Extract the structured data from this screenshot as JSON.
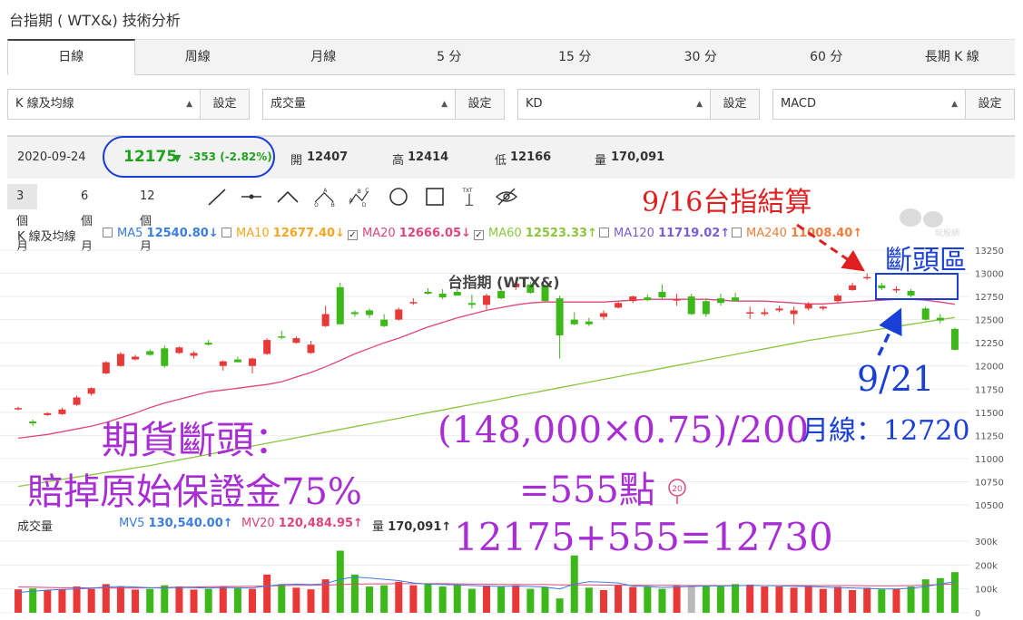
{
  "page": {
    "title": "台指期 ( WTX&) 技術分析"
  },
  "tabs": [
    {
      "label": "日線",
      "active": true
    },
    {
      "label": "周線"
    },
    {
      "label": "月線"
    },
    {
      "label": "5 分"
    },
    {
      "label": "15 分"
    },
    {
      "label": "30 分"
    },
    {
      "label": "60 分"
    },
    {
      "label": "長期 K 線"
    }
  ],
  "selectors": [
    {
      "value": "K 線及均線",
      "button": "設定"
    },
    {
      "value": "成交量",
      "button": "設定"
    },
    {
      "value": "KD",
      "button": "設定"
    },
    {
      "value": "MACD",
      "button": "設定"
    }
  ],
  "quote": {
    "date": "2020-09-24",
    "price": "12175",
    "change": "-353 (-2.82%)",
    "open_label": "開",
    "open": "12407",
    "high_label": "高",
    "high": "12414",
    "low_label": "低",
    "low": "12166",
    "vol_label": "量",
    "vol": "170,091"
  },
  "ranges": [
    "3 個月",
    "6 個月",
    "12 個月"
  ],
  "tools": [
    "line-tool-icon",
    "segment-tool-icon",
    "angle-tool-icon",
    "abc-tool-icon",
    "abcd-tool-icon",
    "circle-tool-icon",
    "rect-tool-icon",
    "text-tool-icon",
    "hide-tool-icon"
  ],
  "tools_text": {
    "text": "TXT"
  },
  "ma_legend": {
    "title": "K 線及均線",
    "items": [
      {
        "name": "MA5",
        "value": "12540.80",
        "arrow": "↓",
        "color": "#3b7de0",
        "checked": false
      },
      {
        "name": "MA10",
        "value": "12677.40",
        "arrow": "↓",
        "color": "#f5a623",
        "checked": false
      },
      {
        "name": "MA20",
        "value": "12666.05",
        "arrow": "↓",
        "color": "#e0457b",
        "checked": true
      },
      {
        "name": "MA60",
        "value": "12523.33",
        "arrow": "↑",
        "color": "#8cc63f",
        "checked": true
      },
      {
        "name": "MA120",
        "value": "11719.02",
        "arrow": "↑",
        "color": "#7b5cd6",
        "checked": false
      },
      {
        "name": "MA240",
        "value": "11008.40",
        "arrow": "↑",
        "color": "#f07e3c",
        "checked": false
      }
    ]
  },
  "vol_legend": {
    "title": "成交量",
    "items": [
      {
        "name": "MV5",
        "value": "130,540.00",
        "arrow": "↑",
        "color": "#3b7de0"
      },
      {
        "name": "MV20",
        "value": "120,484.95",
        "arrow": "↑",
        "color": "#e0457b"
      },
      {
        "name": "量",
        "value": "170,091",
        "arrow": "↑",
        "color": "#333333"
      }
    ]
  },
  "annotations": {
    "settlement": "9/16台指結算",
    "gap_zone": "斷頭區",
    "date_921": "9/21",
    "monthly_line": "月線：12720",
    "liq_title": "期貨斷頭：",
    "liq_desc": "賠掉原始保證金75%",
    "formula": "(148,000×0.75)/200",
    "formula_result": "=555點",
    "sum": "12175+555=12730"
  },
  "watermark": "玩股網",
  "marker_badge": "20",
  "chart_data": {
    "type": "candlestick",
    "title": "台指期 (WTX&)",
    "ylim": [
      10500,
      13250
    ],
    "yticks": [
      10500,
      10750,
      11000,
      11250,
      11500,
      11750,
      12000,
      12250,
      12500,
      12750,
      13000,
      13250
    ],
    "vol_ylim": [
      0,
      300000
    ],
    "vol_ticks": [
      {
        "value": 0,
        "label": "0"
      },
      {
        "value": 100000,
        "label": "100k"
      },
      {
        "value": 200000,
        "label": "200k"
      },
      {
        "value": 300000,
        "label": "300k"
      }
    ],
    "candles": [
      [
        11540,
        11560,
        11520,
        11545
      ],
      [
        11400,
        11420,
        11350,
        11380
      ],
      [
        11470,
        11500,
        11460,
        11490
      ],
      [
        11480,
        11550,
        11470,
        11530
      ],
      [
        11580,
        11680,
        11570,
        11660
      ],
      [
        11700,
        11770,
        11680,
        11760
      ],
      [
        11920,
        12050,
        11910,
        12040
      ],
      [
        12000,
        12150,
        11990,
        12130
      ],
      [
        12070,
        12120,
        12060,
        12100
      ],
      [
        12160,
        12180,
        12110,
        12120
      ],
      [
        12190,
        12220,
        11980,
        12000
      ],
      [
        12140,
        12210,
        12130,
        12200
      ],
      [
        12110,
        12160,
        12080,
        12140
      ],
      [
        12250,
        12280,
        12220,
        12230
      ],
      [
        12000,
        12060,
        11950,
        12050
      ],
      [
        12070,
        12100,
        12040,
        12040
      ],
      [
        12000,
        12090,
        11920,
        12080
      ],
      [
        12130,
        12300,
        12120,
        12280
      ],
      [
        12320,
        12380,
        12290,
        12310
      ],
      [
        12250,
        12320,
        12240,
        12300
      ],
      [
        12140,
        12270,
        12130,
        12230
      ],
      [
        12430,
        12650,
        12420,
        12560
      ],
      [
        12850,
        12900,
        12480,
        12450
      ],
      [
        12580,
        12600,
        12530,
        12560
      ],
      [
        12600,
        12620,
        12520,
        12550
      ],
      [
        12500,
        12560,
        12420,
        12430
      ],
      [
        12500,
        12630,
        12490,
        12610
      ],
      [
        12680,
        12730,
        12660,
        12690
      ],
      [
        12800,
        12840,
        12770,
        12780
      ],
      [
        12780,
        12830,
        12720,
        12740
      ],
      [
        12800,
        12850,
        12780,
        12760
      ],
      [
        12680,
        12770,
        12620,
        12660
      ],
      [
        12660,
        12780,
        12610,
        12760
      ],
      [
        12810,
        12830,
        12720,
        12730
      ],
      [
        12850,
        12900,
        12820,
        12890
      ],
      [
        12880,
        12910,
        12780,
        12790
      ],
      [
        12870,
        12880,
        12690,
        12700
      ],
      [
        12730,
        12760,
        12080,
        12330
      ],
      [
        12500,
        12580,
        12440,
        12450
      ],
      [
        12480,
        12520,
        12430,
        12450
      ],
      [
        12530,
        12600,
        12500,
        12570
      ],
      [
        12630,
        12690,
        12620,
        12680
      ],
      [
        12700,
        12760,
        12680,
        12750
      ],
      [
        12740,
        12770,
        12700,
        12710
      ],
      [
        12800,
        12880,
        12720,
        12740
      ],
      [
        12710,
        12780,
        12650,
        12720
      ],
      [
        12750,
        12780,
        12550,
        12560
      ],
      [
        12700,
        12730,
        12530,
        12560
      ],
      [
        12730,
        12780,
        12650,
        12680
      ],
      [
        12740,
        12790,
        12700,
        12700
      ],
      [
        12580,
        12640,
        12510,
        12580
      ],
      [
        12560,
        12620,
        12540,
        12580
      ],
      [
        12600,
        12650,
        12580,
        12620
      ],
      [
        12560,
        12640,
        12450,
        12600
      ],
      [
        12620,
        12690,
        12600,
        12670
      ],
      [
        12620,
        12650,
        12600,
        12640
      ],
      [
        12700,
        12780,
        12680,
        12760
      ],
      [
        12820,
        12900,
        12810,
        12870
      ],
      [
        12950,
        13000,
        12930,
        12960
      ],
      [
        12870,
        12900,
        12820,
        12840
      ],
      [
        12820,
        12860,
        12790,
        12830
      ],
      [
        12810,
        12830,
        12740,
        12760
      ],
      [
        12620,
        12640,
        12490,
        12500
      ],
      [
        12520,
        12560,
        12460,
        12490
      ],
      [
        12400,
        12414,
        12166,
        12175
      ]
    ],
    "ma20": [
      11220,
      11240,
      11260,
      11290,
      11320,
      11350,
      11390,
      11440,
      11490,
      11550,
      11600,
      11640,
      11680,
      11720,
      11740,
      11760,
      11780,
      11800,
      11830,
      11880,
      11930,
      11990,
      12060,
      12130,
      12190,
      12250,
      12300,
      12360,
      12420,
      12470,
      12520,
      12560,
      12600,
      12630,
      12660,
      12680,
      12690,
      12690,
      12690,
      12690,
      12690,
      12700,
      12710,
      12720,
      12720,
      12720,
      12720,
      12720,
      12710,
      12700,
      12700,
      12700,
      12690,
      12680,
      12670,
      12670,
      12680,
      12690,
      12700,
      12710,
      12720,
      12720,
      12710,
      12690,
      12666
    ],
    "ma60": [
      10700,
      10725,
      10750,
      10775,
      10800,
      10825,
      10850,
      10875,
      10900,
      10925,
      10955,
      10985,
      11015,
      11045,
      11075,
      11105,
      11135,
      11165,
      11195,
      11225,
      11255,
      11285,
      11315,
      11345,
      11375,
      11405,
      11435,
      11465,
      11495,
      11525,
      11555,
      11585,
      11615,
      11645,
      11675,
      11705,
      11735,
      11765,
      11795,
      11825,
      11855,
      11885,
      11915,
      11945,
      11975,
      12005,
      12035,
      12065,
      12095,
      12125,
      12155,
      12185,
      12215,
      12245,
      12275,
      12300,
      12325,
      12350,
      12375,
      12400,
      12425,
      12450,
      12475,
      12500,
      12523
    ],
    "volumes": [
      98000,
      102000,
      95000,
      97000,
      110000,
      100000,
      120000,
      108000,
      97000,
      100000,
      115000,
      110000,
      97000,
      100000,
      108000,
      103000,
      100000,
      160000,
      120000,
      105000,
      98000,
      140000,
      260000,
      160000,
      110000,
      115000,
      130000,
      115000,
      120000,
      110000,
      118000,
      100000,
      114000,
      110000,
      115000,
      100000,
      108000,
      60000,
      240000,
      105000,
      95000,
      115000,
      108000,
      110000,
      100000,
      113000,
      110000,
      115000,
      110000,
      120000,
      118000,
      110000,
      110000,
      105000,
      114000,
      100000,
      109000,
      95000,
      105000,
      98000,
      100000,
      110000,
      140000,
      145000,
      170091
    ],
    "vol_neutral_index": 46,
    "mv5": [
      85000,
      90000,
      95000,
      98000,
      100000,
      103000,
      108000,
      110000,
      108000,
      105000,
      104000,
      106000,
      105000,
      104000,
      106000,
      105000,
      104000,
      112000,
      118000,
      120000,
      118000,
      122000,
      140000,
      150000,
      145000,
      140000,
      135000,
      125000,
      120000,
      118000,
      117000,
      114000,
      112000,
      110000,
      112000,
      110000,
      108000,
      100000,
      120000,
      130000,
      128000,
      125000,
      112000,
      110000,
      106000,
      108000,
      110000,
      112000,
      112000,
      113000,
      115000,
      114000,
      113000,
      111000,
      110000,
      108000,
      106000,
      104000,
      102000,
      100000,
      100000,
      103000,
      110000,
      120000,
      130540
    ],
    "mv20": [
      108000,
      107000,
      106000,
      105000,
      105000,
      104000,
      104000,
      104000,
      104000,
      105000,
      106000,
      107000,
      108000,
      109000,
      110000,
      110000,
      111000,
      112000,
      114000,
      115000,
      115000,
      116000,
      118000,
      120000,
      121000,
      121000,
      122000,
      122000,
      122000,
      122000,
      121000,
      120000,
      120000,
      119000,
      119000,
      118000,
      118000,
      117000,
      117000,
      117000,
      116000,
      116000,
      115000,
      115000,
      115000,
      115000,
      114000,
      114000,
      114000,
      114000,
      114000,
      114000,
      114000,
      114000,
      114000,
      114000,
      114000,
      114000,
      113000,
      113000,
      113000,
      114000,
      116000,
      118000,
      120485
    ]
  }
}
